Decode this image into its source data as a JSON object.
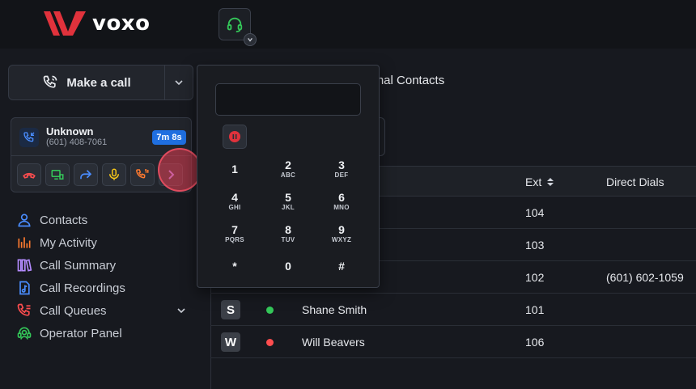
{
  "brand": {
    "name": "voxo",
    "accent": "#e0323c"
  },
  "header": {
    "headset_icon": "headset-icon"
  },
  "make_call": {
    "label": "Make a call"
  },
  "active_call": {
    "caller_name": "Unknown",
    "caller_number": "(601) 408-7061",
    "duration": "7m 8s",
    "actions": [
      "hangup-icon",
      "transfer-screen-icon",
      "forward-icon",
      "microphone-icon",
      "voicemail-icon",
      "more-icon"
    ]
  },
  "nav": {
    "items": [
      {
        "label": "Contacts",
        "icon": "contacts-icon"
      },
      {
        "label": "My Activity",
        "icon": "activity-icon"
      },
      {
        "label": "Call Summary",
        "icon": "summary-icon"
      },
      {
        "label": "Call Recordings",
        "icon": "recordings-icon"
      },
      {
        "label": "Call Queues",
        "icon": "queues-icon"
      },
      {
        "label": "Operator Panel",
        "icon": "operator-icon"
      }
    ]
  },
  "main": {
    "section_title_partial": "sonal Contacts"
  },
  "table": {
    "headers": {
      "ext": "Ext",
      "direct_dials": "Direct Dials"
    },
    "rows": [
      {
        "avatar": "",
        "status": "",
        "name": "",
        "ext": "104",
        "direct_dial": ""
      },
      {
        "avatar": "",
        "status": "",
        "name": "",
        "ext": "103",
        "direct_dial": ""
      },
      {
        "avatar": "",
        "status": "",
        "name": "",
        "ext": "102",
        "direct_dial": "(601) 602-1059"
      },
      {
        "avatar": "S",
        "status": "#34c759",
        "name": "Shane Smith",
        "ext": "101",
        "direct_dial": ""
      },
      {
        "avatar": "W",
        "status": "#ff4d4f",
        "name": "Will Beavers",
        "ext": "106",
        "direct_dial": ""
      }
    ]
  },
  "dialpad": {
    "input_value": "",
    "keys": [
      {
        "digit": "1",
        "letters": ""
      },
      {
        "digit": "2",
        "letters": "ABC"
      },
      {
        "digit": "3",
        "letters": "DEF"
      },
      {
        "digit": "4",
        "letters": "GHI"
      },
      {
        "digit": "5",
        "letters": "JKL"
      },
      {
        "digit": "6",
        "letters": "MNO"
      },
      {
        "digit": "7",
        "letters": "PQRS"
      },
      {
        "digit": "8",
        "letters": "TUV"
      },
      {
        "digit": "9",
        "letters": "WXYZ"
      },
      {
        "digit": "*",
        "letters": ""
      },
      {
        "digit": "0",
        "letters": ""
      },
      {
        "digit": "#",
        "letters": ""
      }
    ]
  }
}
